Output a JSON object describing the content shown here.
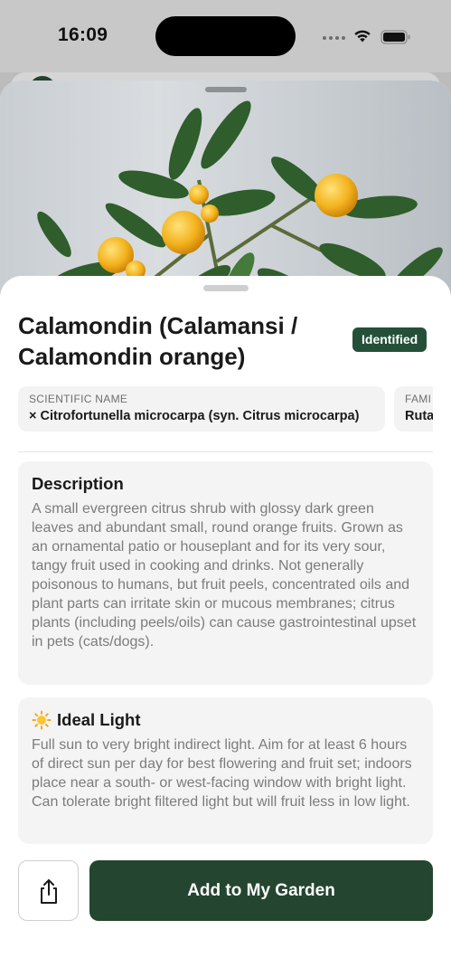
{
  "status_bar": {
    "time": "16:09"
  },
  "plant": {
    "name": "Calamondin (Calamansi / Calamondin orange)",
    "status": "Identified"
  },
  "info_chips": [
    {
      "label": "SCIENTIFIC NAME",
      "value": "× Citrofortunella microcarpa (syn. Citrus microcarpa)"
    },
    {
      "label": "FAMI",
      "value": "Ruta"
    }
  ],
  "sections": {
    "description": {
      "title": "Description",
      "body": "A small evergreen citrus shrub with glossy dark green leaves and abundant small, round orange fruits. Grown as an ornamental patio or houseplant and for its very sour, tangy fruit used in cooking and drinks. Not generally poisonous to humans, but fruit peels, concentrated oils and plant parts can irritate skin or mucous membranes; citrus plants (including peels/oils) can cause gastrointestinal upset in pets (cats/dogs)."
    },
    "ideal_light": {
      "icon": "sun-icon",
      "title": "Ideal Light",
      "body": "Full sun to very bright indirect light. Aim for at least 6 hours of direct sun per day for best flowering and fruit set; indoors place near a south- or west-facing window with bright light. Can tolerate bright filtered light but will fruit less in low light."
    }
  },
  "actions": {
    "share_icon": "share-icon",
    "add_label": "Add to My Garden"
  },
  "colors": {
    "accent": "#24452f",
    "badge": "#24503a"
  }
}
